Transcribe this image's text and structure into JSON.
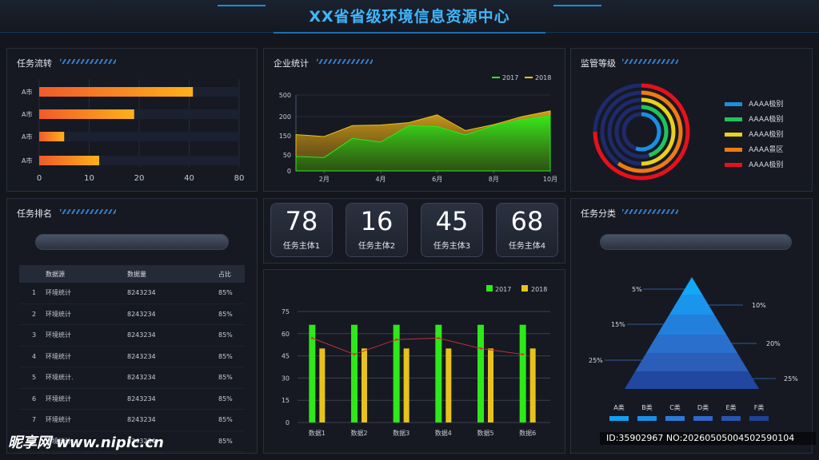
{
  "header": {
    "title": "XX省省级环境信息资源中心"
  },
  "panels": {
    "task_flow": "任务流转",
    "enterprise": "企业统计",
    "supervision": "监管等级",
    "ranking": "任务排名",
    "category": "任务分类"
  },
  "kpis": [
    {
      "value": "78",
      "label": "任务主体1"
    },
    {
      "value": "16",
      "label": "任务主体2"
    },
    {
      "value": "45",
      "label": "任务主体3"
    },
    {
      "value": "68",
      "label": "任务主体4"
    }
  ],
  "colors": {
    "accent": "#3fb7ff",
    "green": "#2ee81a",
    "yellow": "#e8c21a",
    "orange": "#f07a2a",
    "red": "#e8101a"
  },
  "ranking_table": {
    "headers": [
      "数据源",
      "数据量",
      "占比"
    ],
    "rows": [
      {
        "no": "1",
        "name": "环境统计",
        "amount": "8243234",
        "ratio": "85%"
      },
      {
        "no": "2",
        "name": "环境统计",
        "amount": "8243234",
        "ratio": "85%"
      },
      {
        "no": "3",
        "name": "环境统计",
        "amount": "8243234",
        "ratio": "85%"
      },
      {
        "no": "4",
        "name": "环境统计",
        "amount": "8243234",
        "ratio": "85%"
      },
      {
        "no": "5",
        "name": "环境统计.",
        "amount": "8243234",
        "ratio": "85%"
      },
      {
        "no": "6",
        "name": "环境统计",
        "amount": "8243234",
        "ratio": "85%"
      },
      {
        "no": "7",
        "name": "环境统计",
        "amount": "8243234",
        "ratio": "85%"
      },
      {
        "no": "8",
        "name": "环境统计.",
        "amount": "8243234",
        "ratio": "85%"
      }
    ]
  },
  "supervision_legend": [
    {
      "label": "AAAA极别",
      "color": "#1a8fe0"
    },
    {
      "label": "AAAA极别",
      "color": "#22c35a"
    },
    {
      "label": "AAAA极别",
      "color": "#e8d21a"
    },
    {
      "label": "AAAA景区",
      "color": "#f07a12"
    },
    {
      "label": "AAAA极别",
      "color": "#e8101a"
    }
  ],
  "watermark": {
    "logo": "昵享网 www.nipic.cn",
    "id": "ID:35902967 NO:20260505004502590104"
  },
  "chart_data": [
    {
      "type": "bar",
      "orientation": "horizontal",
      "categories": [
        "A市",
        "A市",
        "A市",
        "A市"
      ],
      "values": [
        43,
        19,
        5,
        12
      ],
      "xlim": [
        0,
        80
      ],
      "xticks": [
        "0",
        "10",
        "20",
        "40",
        "80"
      ],
      "grid": true
    },
    {
      "type": "area",
      "x": [
        1,
        2,
        3,
        4,
        5,
        6,
        7,
        8,
        9,
        10
      ],
      "xticks": [
        "2月",
        "4月",
        "6月",
        "8月",
        "10月"
      ],
      "yticks": [
        "0",
        "50",
        "100",
        "150",
        "200",
        "500"
      ],
      "series": [
        {
          "name": "2017",
          "values": [
            45,
            42,
            95,
            85,
            155,
            150,
            108,
            155,
            185,
            210
          ],
          "color": "#2ee81a"
        },
        {
          "name": "2018",
          "values": [
            110,
            100,
            155,
            158,
            170,
            225,
            130,
            160,
            200,
            280
          ],
          "color": "#e8c21a"
        }
      ],
      "legend": "top-right"
    },
    {
      "type": "pie",
      "style": "concentric-rings",
      "rings": [
        {
          "color": "#e8101a",
          "fraction": 0.75
        },
        {
          "color": "#f07a12",
          "fraction": 0.6
        },
        {
          "color": "#e8d21a",
          "fraction": 0.5
        },
        {
          "color": "#22c35a",
          "fraction": 0.45
        },
        {
          "color": "#1a8fe0",
          "fraction": 0.55
        }
      ]
    },
    {
      "type": "bar",
      "categories": [
        "数据1",
        "数据2",
        "数据3",
        "数据4",
        "数据5",
        "数据6"
      ],
      "series": [
        {
          "name": "2017",
          "values": [
            66,
            66,
            66,
            66,
            66,
            66
          ],
          "color": "#2ee81a"
        },
        {
          "name": "2018",
          "values": [
            50,
            50,
            50,
            50,
            50,
            50
          ],
          "color": "#e8c21a"
        }
      ],
      "trend_line": [
        57,
        46,
        56,
        57,
        50,
        46
      ],
      "yticks": [
        "0",
        "15",
        "30",
        "45",
        "60",
        "75"
      ],
      "ylim": [
        0,
        75
      ],
      "legend": "top-right",
      "grid": true
    },
    {
      "type": "pie",
      "style": "pyramid",
      "categories": [
        "A类",
        "B类",
        "C类",
        "D类",
        "E类",
        "F类"
      ],
      "labels": [
        "5%",
        "10%",
        "15%",
        "20%",
        "25%",
        "25%"
      ],
      "colors": [
        "#12a0f0",
        "#1c8de6",
        "#2a7ad8",
        "#2f66c8",
        "#2754b0",
        "#1e4296"
      ]
    }
  ]
}
